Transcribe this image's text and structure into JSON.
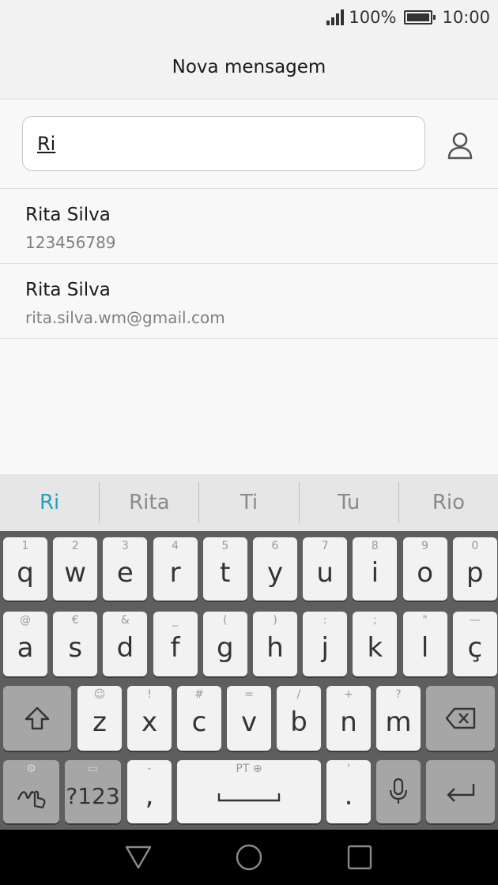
{
  "status": {
    "battery": "100%",
    "time": "10:00"
  },
  "header": {
    "title": "Nova mensagem"
  },
  "recipient": {
    "value": "Ri"
  },
  "suggestions": [
    {
      "name": "Rita Silva",
      "detail": "123456789"
    },
    {
      "name": "Rita Silva",
      "detail": "rita.silva.wm@gmail.com"
    }
  ],
  "keyboard": {
    "predictions": [
      "Ri",
      "Rita",
      "Ti",
      "Tu",
      "Rio"
    ],
    "row1": [
      {
        "k": "q",
        "h": "1"
      },
      {
        "k": "w",
        "h": "2"
      },
      {
        "k": "e",
        "h": "3"
      },
      {
        "k": "r",
        "h": "4"
      },
      {
        "k": "t",
        "h": "5"
      },
      {
        "k": "y",
        "h": "6"
      },
      {
        "k": "u",
        "h": "7"
      },
      {
        "k": "i",
        "h": "8"
      },
      {
        "k": "o",
        "h": "9"
      },
      {
        "k": "p",
        "h": "0"
      }
    ],
    "row2": [
      {
        "k": "a",
        "h": "@"
      },
      {
        "k": "s",
        "h": "€"
      },
      {
        "k": "d",
        "h": "&"
      },
      {
        "k": "f",
        "h": "_"
      },
      {
        "k": "g",
        "h": "("
      },
      {
        "k": "h",
        "h": ")"
      },
      {
        "k": "j",
        "h": ":"
      },
      {
        "k": "k",
        "h": ";"
      },
      {
        "k": "l",
        "h": "\""
      },
      {
        "k": "ç",
        "h": "—"
      }
    ],
    "row3": [
      {
        "k": "z",
        "h": "☺"
      },
      {
        "k": "x",
        "h": "!"
      },
      {
        "k": "c",
        "h": "#"
      },
      {
        "k": "v",
        "h": "="
      },
      {
        "k": "b",
        "h": "/"
      },
      {
        "k": "n",
        "h": "+"
      },
      {
        "k": "m",
        "h": "?"
      }
    ],
    "symbols_label": "?123",
    "comma_label": ",",
    "comma_hint": "-",
    "space_hint": "PT ⊕",
    "period_label": ".",
    "period_hint": "'"
  },
  "colors": {
    "accent": "#1fa3b8",
    "keyboard_bg": "#5e5e5e",
    "key_bg": "#f2f2f2",
    "key_dark_bg": "#a6a6a6"
  }
}
